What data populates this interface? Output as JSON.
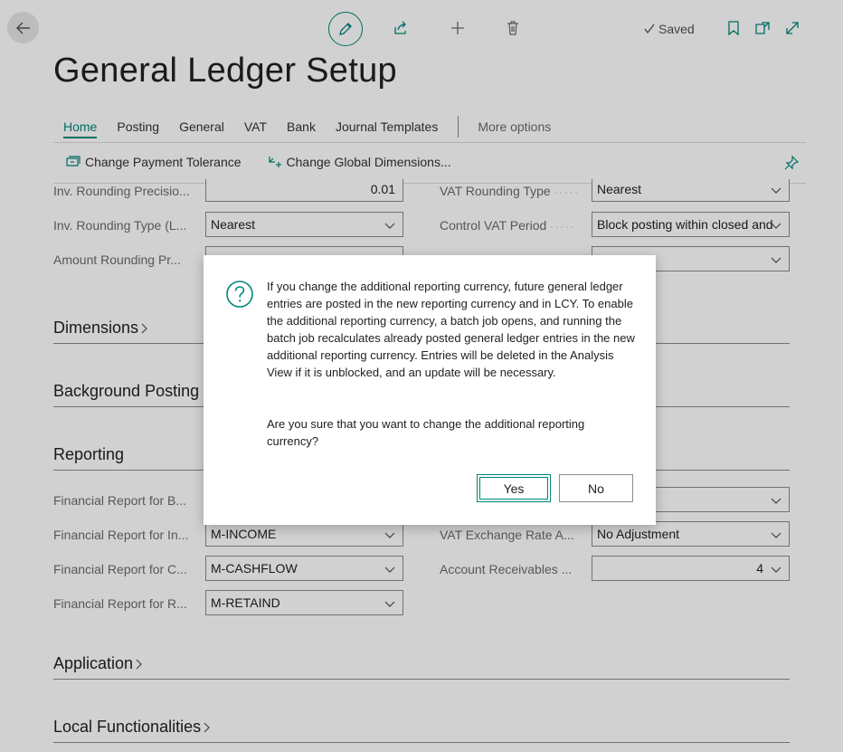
{
  "header": {
    "title": "General Ledger Setup",
    "saved_label": "Saved"
  },
  "tabs": [
    {
      "label": "Home"
    },
    {
      "label": "Posting"
    },
    {
      "label": "General"
    },
    {
      "label": "VAT"
    },
    {
      "label": "Bank"
    },
    {
      "label": "Journal Templates"
    }
  ],
  "more_options": "More options",
  "actions": {
    "change_payment_tolerance": "Change Payment Tolerance",
    "change_global_dimensions": "Change Global Dimensions..."
  },
  "fields": {
    "inv_rounding_precision": {
      "label": "Inv. Rounding Precisio...",
      "value": "0.01"
    },
    "inv_rounding_type": {
      "label": "Inv. Rounding Type (L...",
      "value": "Nearest"
    },
    "amount_rounding_precision": {
      "label": "Amount Rounding Pr...",
      "value": ""
    },
    "vat_rounding_type": {
      "label": "VAT Rounding Type",
      "value": "Nearest"
    },
    "control_vat_period": {
      "label": "Control VAT Period",
      "value": "Block posting within closed and"
    },
    "fin_report_balance": {
      "label": "Financial Report for B...",
      "value": ""
    },
    "fin_report_income": {
      "label": "Financial Report for In...",
      "value": "M-INCOME"
    },
    "fin_report_cashflow": {
      "label": "Financial Report for C...",
      "value": "M-CASHFLOW"
    },
    "fin_report_retained": {
      "label": "Financial Report for R...",
      "value": "M-RETAIND"
    },
    "vat_exchange_rate": {
      "label": "VAT Exchange Rate A...",
      "value": "No Adjustment"
    },
    "account_receivables": {
      "label": "Account Receivables ...",
      "value": "4"
    }
  },
  "sections": {
    "dimensions": "Dimensions",
    "background_posting": "Background Posting",
    "reporting": "Reporting",
    "application": "Application",
    "local_functionalities": "Local Functionalities"
  },
  "dialog": {
    "message": "If you change the additional reporting currency, future general ledger entries are posted in the new reporting currency and in LCY. To enable the additional reporting currency, a batch job opens, and running the batch job recalculates already posted general ledger entries in the new additional reporting currency. Entries will be deleted in the Analysis View if it is unblocked, and an update will be necessary.",
    "question": "Are you sure that you want to change the additional reporting currency?",
    "yes_label": "Yes",
    "no_label": "No"
  },
  "colors": {
    "accent": "#00857a",
    "overlay": "rgba(0,0,0,0.18)"
  }
}
